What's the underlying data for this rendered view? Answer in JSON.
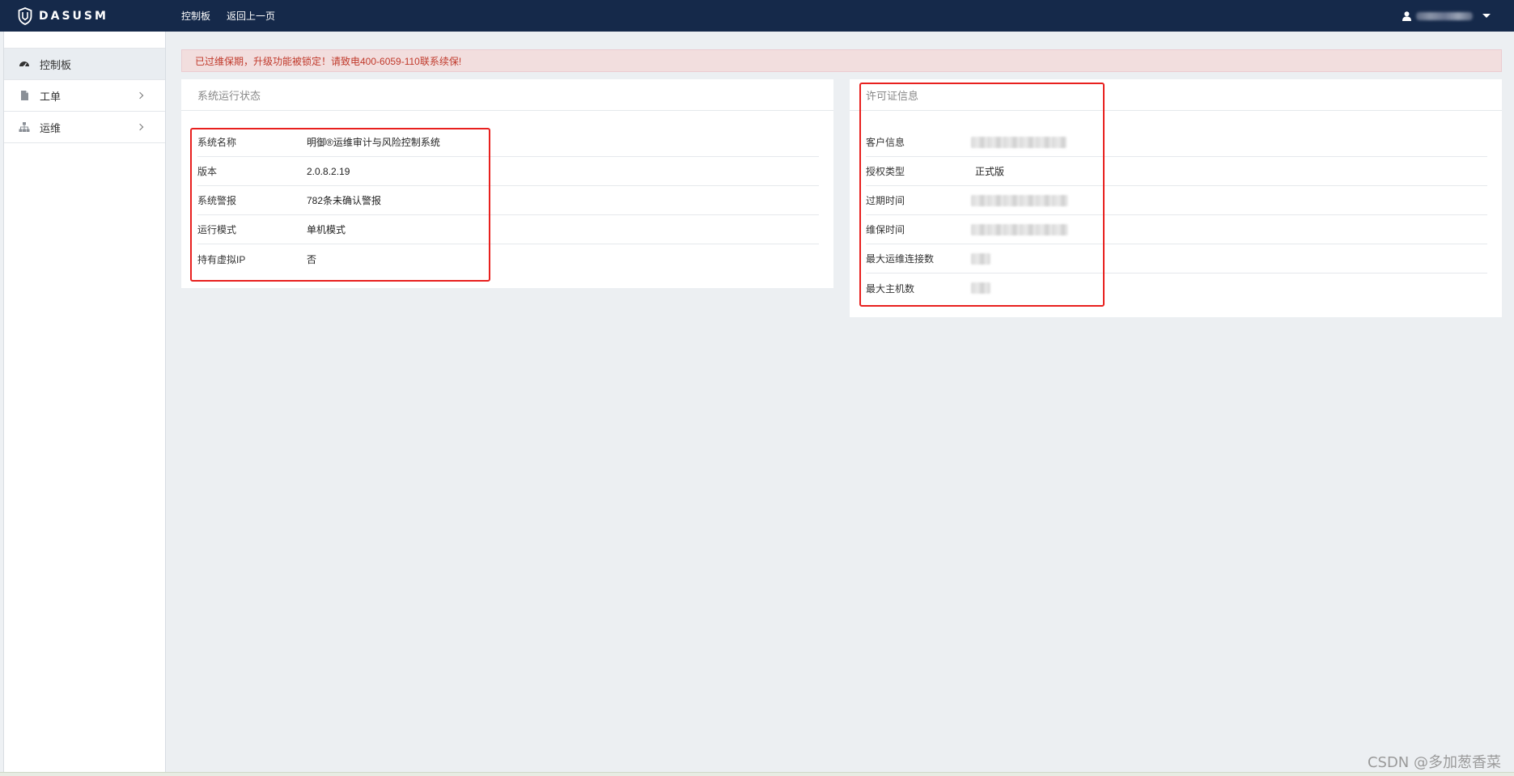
{
  "brand": {
    "name": "DASUSM"
  },
  "topnav": {
    "items": [
      "控制板",
      "返回上一页"
    ]
  },
  "user": {
    "name_hidden": true
  },
  "sidebar": {
    "items": [
      {
        "label": "控制板",
        "icon": "dashboard-icon",
        "active": true
      },
      {
        "label": "工单",
        "icon": "document-icon",
        "has_children": true
      },
      {
        "label": "运维",
        "icon": "sitemap-icon",
        "has_children": true
      }
    ]
  },
  "alert": {
    "text": "已过维保期，升级功能被锁定！请致电400-6059-110联系续保!"
  },
  "system_status": {
    "title": "系统运行状态",
    "rows": [
      {
        "label": "系统名称",
        "value": "明御®运维审计与风险控制系统"
      },
      {
        "label": "版本",
        "value": "2.0.8.2.19"
      },
      {
        "label": "系统警报",
        "value": "782条未确认警报"
      },
      {
        "label": "运行模式",
        "value": "单机模式"
      },
      {
        "label": "持有虚拟IP",
        "value": "否"
      }
    ]
  },
  "license": {
    "title": "许可证信息",
    "rows": [
      {
        "label": "客户信息",
        "value": ""
      },
      {
        "label": "授权类型",
        "value": "正式版"
      },
      {
        "label": "过期时间",
        "value": ""
      },
      {
        "label": "维保时间",
        "value": ""
      },
      {
        "label": "最大运维连接数",
        "value": ""
      },
      {
        "label": "最大主机数",
        "value": ""
      }
    ]
  },
  "watermark": "CSDN @多加葱香菜",
  "colors": {
    "navbar": "#15294a",
    "alert_bg": "#f2dede",
    "alert_text": "#c0392b",
    "highlight_box": "#e8201e",
    "content_bg": "#eceff2"
  }
}
